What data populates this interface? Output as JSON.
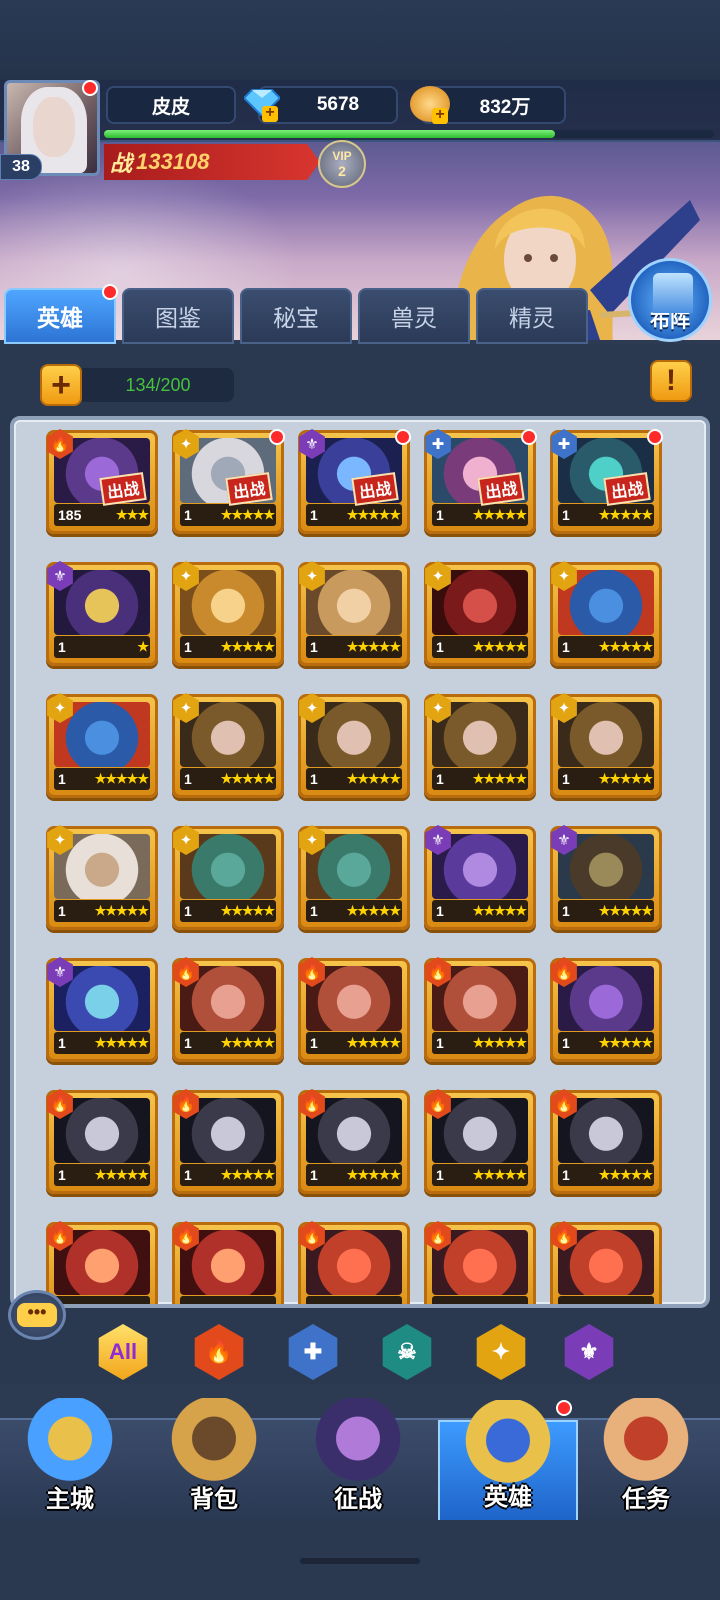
{
  "player": {
    "name": "皮皮",
    "level": "38",
    "diamonds": "5678",
    "gold": "832万",
    "power_label": "战",
    "power": "133108",
    "vip_label": "VIP",
    "vip_level": "2",
    "exp_progress": 0.74
  },
  "tabs": [
    {
      "label": "英雄",
      "active": true
    },
    {
      "label": "图鉴",
      "active": false
    },
    {
      "label": "秘宝",
      "active": false
    },
    {
      "label": "兽灵",
      "active": false
    },
    {
      "label": "精灵",
      "active": false
    }
  ],
  "formation_label": "布阵",
  "capacity": "134/200",
  "deploy_tag": "出战",
  "heroes": [
    {
      "faction": "fire",
      "level": "185",
      "stars": 3,
      "star_color": "pink",
      "deployed": true,
      "dot": false,
      "theme": "purple"
    },
    {
      "faction": "holy",
      "level": "1",
      "stars": 5,
      "deployed": true,
      "dot": true,
      "theme": "white"
    },
    {
      "faction": "dark",
      "level": "1",
      "stars": 5,
      "deployed": true,
      "dot": true,
      "theme": "blue"
    },
    {
      "faction": "water",
      "level": "1",
      "stars": 5,
      "deployed": true,
      "dot": true,
      "theme": "pinkhair"
    },
    {
      "faction": "water",
      "level": "1",
      "stars": 5,
      "deployed": true,
      "dot": true,
      "theme": "teal"
    },
    {
      "faction": "dark",
      "level": "1",
      "stars": 1,
      "star_color": "pink",
      "deployed": false,
      "dot": false,
      "theme": "mask"
    },
    {
      "faction": "holy",
      "level": "1",
      "stars": 5,
      "deployed": false,
      "dot": false,
      "theme": "blonde"
    },
    {
      "faction": "holy",
      "level": "1",
      "stars": 5,
      "deployed": false,
      "dot": false,
      "theme": "elf"
    },
    {
      "faction": "holy",
      "level": "1",
      "stars": 5,
      "deployed": false,
      "dot": false,
      "theme": "red"
    },
    {
      "faction": "holy",
      "level": "1",
      "stars": 5,
      "deployed": false,
      "dot": false,
      "theme": "troll"
    },
    {
      "faction": "holy",
      "level": "1",
      "stars": 5,
      "deployed": false,
      "dot": false,
      "theme": "troll"
    },
    {
      "faction": "holy",
      "level": "1",
      "stars": 5,
      "deployed": false,
      "dot": false,
      "theme": "hood"
    },
    {
      "faction": "holy",
      "level": "1",
      "stars": 5,
      "deployed": false,
      "dot": false,
      "theme": "hood"
    },
    {
      "faction": "holy",
      "level": "1",
      "stars": 5,
      "deployed": false,
      "dot": false,
      "theme": "hood"
    },
    {
      "faction": "holy",
      "level": "1",
      "stars": 5,
      "deployed": false,
      "dot": false,
      "theme": "hood"
    },
    {
      "faction": "holy",
      "level": "1",
      "stars": 5,
      "deployed": false,
      "dot": false,
      "theme": "whitehood"
    },
    {
      "faction": "holy",
      "level": "1",
      "stars": 5,
      "deployed": false,
      "dot": false,
      "theme": "orc"
    },
    {
      "faction": "holy",
      "level": "1",
      "stars": 5,
      "deployed": false,
      "dot": false,
      "theme": "orc"
    },
    {
      "faction": "dark",
      "level": "1",
      "stars": 5,
      "deployed": false,
      "dot": false,
      "theme": "violet"
    },
    {
      "faction": "dark",
      "level": "1",
      "stars": 5,
      "deployed": false,
      "dot": false,
      "theme": "armor"
    },
    {
      "faction": "dark",
      "level": "1",
      "stars": 5,
      "deployed": false,
      "dot": false,
      "theme": "ice"
    },
    {
      "faction": "fire",
      "level": "1",
      "stars": 5,
      "deployed": false,
      "dot": false,
      "theme": "demon"
    },
    {
      "faction": "fire",
      "level": "1",
      "stars": 5,
      "deployed": false,
      "dot": false,
      "theme": "demon"
    },
    {
      "faction": "fire",
      "level": "1",
      "stars": 5,
      "deployed": false,
      "dot": false,
      "theme": "demon"
    },
    {
      "faction": "fire",
      "level": "1",
      "stars": 5,
      "deployed": false,
      "dot": false,
      "theme": "purple"
    },
    {
      "faction": "fire",
      "level": "1",
      "stars": 5,
      "deployed": false,
      "dot": false,
      "theme": "shadow"
    },
    {
      "faction": "fire",
      "level": "1",
      "stars": 5,
      "deployed": false,
      "dot": false,
      "theme": "shadow"
    },
    {
      "faction": "fire",
      "level": "1",
      "stars": 5,
      "deployed": false,
      "dot": false,
      "theme": "shadow"
    },
    {
      "faction": "fire",
      "level": "1",
      "stars": 5,
      "deployed": false,
      "dot": false,
      "theme": "shadow"
    },
    {
      "faction": "fire",
      "level": "1",
      "stars": 5,
      "deployed": false,
      "dot": false,
      "theme": "shadow"
    },
    {
      "faction": "fire",
      "level": "",
      "stars": 0,
      "deployed": false,
      "dot": false,
      "theme": "redwing"
    },
    {
      "faction": "fire",
      "level": "",
      "stars": 0,
      "deployed": false,
      "dot": false,
      "theme": "redwing"
    },
    {
      "faction": "fire",
      "level": "",
      "stars": 0,
      "deployed": false,
      "dot": false,
      "theme": "flame"
    },
    {
      "faction": "fire",
      "level": "",
      "stars": 0,
      "deployed": false,
      "dot": false,
      "theme": "flame"
    },
    {
      "faction": "fire",
      "level": "",
      "stars": 0,
      "deployed": false,
      "dot": false,
      "theme": "flame"
    }
  ],
  "filters": [
    {
      "label": "All",
      "icon": "all",
      "color": "#ffd23c"
    },
    {
      "label": "",
      "icon": "fire-faction-icon",
      "color": "#e2491b"
    },
    {
      "label": "",
      "icon": "water-faction-icon",
      "color": "#3f73c9"
    },
    {
      "label": "",
      "icon": "skull-faction-icon",
      "color": "#1e8c83"
    },
    {
      "label": "",
      "icon": "holy-faction-icon",
      "color": "#e3a412"
    },
    {
      "label": "",
      "icon": "dark-faction-icon",
      "color": "#7a3db7"
    }
  ],
  "nav": [
    {
      "label": "主城",
      "icon": "castle-icon",
      "active": false
    },
    {
      "label": "背包",
      "icon": "chest-icon",
      "active": false
    },
    {
      "label": "征战",
      "icon": "portal-dragon-icon",
      "active": false
    },
    {
      "label": "英雄",
      "icon": "helmet-icon",
      "active": true
    },
    {
      "label": "任务",
      "icon": "scroll-icon",
      "active": false
    }
  ],
  "colors": {
    "accent": "#2d74d4",
    "gold": "#f2a51a",
    "panel": "#c6d0dd",
    "alert": "#ff2a2a"
  }
}
